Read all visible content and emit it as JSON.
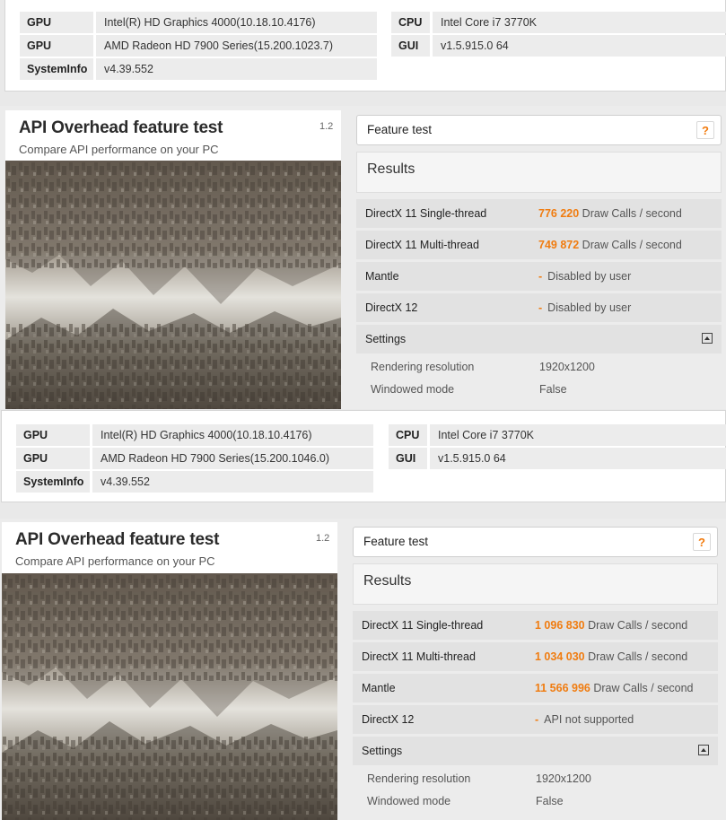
{
  "sysinfo_top": {
    "rows_left": [
      {
        "label": "GPU",
        "value": "Intel(R) HD Graphics 4000(10.18.10.4176)"
      },
      {
        "label": "GPU",
        "value": "AMD Radeon HD 7900 Series(15.200.1023.7)"
      },
      {
        "label": "SystemInfo",
        "value": "v4.39.552"
      }
    ],
    "rows_right": [
      {
        "label": "CPU",
        "value": "Intel Core i7 3770K"
      },
      {
        "label": "GUI",
        "value": "v1.5.915.0 64"
      }
    ]
  },
  "result_top": {
    "title": "API Overhead feature test",
    "subtitle": "Compare API performance on your PC",
    "version": "1.2",
    "feature_label": "Feature test",
    "help_label": "?",
    "results_label": "Results",
    "rows": [
      {
        "name": "DirectX 11 Single-thread",
        "value": "776 220",
        "unit": "Draw Calls / second"
      },
      {
        "name": "DirectX 11 Multi-thread",
        "value": "749 872",
        "unit": "Draw Calls / second"
      },
      {
        "name": "Mantle",
        "value": "-",
        "unit": "Disabled by user"
      },
      {
        "name": "DirectX 12",
        "value": "-",
        "unit": "Disabled by user"
      }
    ],
    "settings_label": "Settings",
    "settings": [
      {
        "name": "Rendering resolution",
        "value": "1920x1200"
      },
      {
        "name": "Windowed mode",
        "value": "False"
      }
    ]
  },
  "sysinfo_mid": {
    "rows_left": [
      {
        "label": "GPU",
        "value": "Intel(R) HD Graphics 4000(10.18.10.4176)"
      },
      {
        "label": "GPU",
        "value": "AMD Radeon HD 7900 Series(15.200.1046.0)"
      },
      {
        "label": "SystemInfo",
        "value": "v4.39.552"
      }
    ],
    "rows_right": [
      {
        "label": "CPU",
        "value": "Intel Core i7 3770K"
      },
      {
        "label": "GUI",
        "value": "v1.5.915.0 64"
      }
    ]
  },
  "result_bottom": {
    "title": "API Overhead feature test",
    "subtitle": "Compare API performance on your PC",
    "version": "1.2",
    "feature_label": "Feature test",
    "help_label": "?",
    "results_label": "Results",
    "rows": [
      {
        "name": "DirectX 11 Single-thread",
        "value": "1 096 830",
        "unit": "Draw Calls / second"
      },
      {
        "name": "DirectX 11 Multi-thread",
        "value": "1 034 030",
        "unit": "Draw Calls / second"
      },
      {
        "name": "Mantle",
        "value": "11 566 996",
        "unit": "Draw Calls / second"
      },
      {
        "name": "DirectX 12",
        "value": "-",
        "unit": "API not supported"
      }
    ],
    "settings_label": "Settings",
    "settings": [
      {
        "name": "Rendering resolution",
        "value": "1920x1200"
      },
      {
        "name": "Windowed mode",
        "value": "False"
      }
    ]
  },
  "colors": {
    "accent": "#f07c10"
  }
}
